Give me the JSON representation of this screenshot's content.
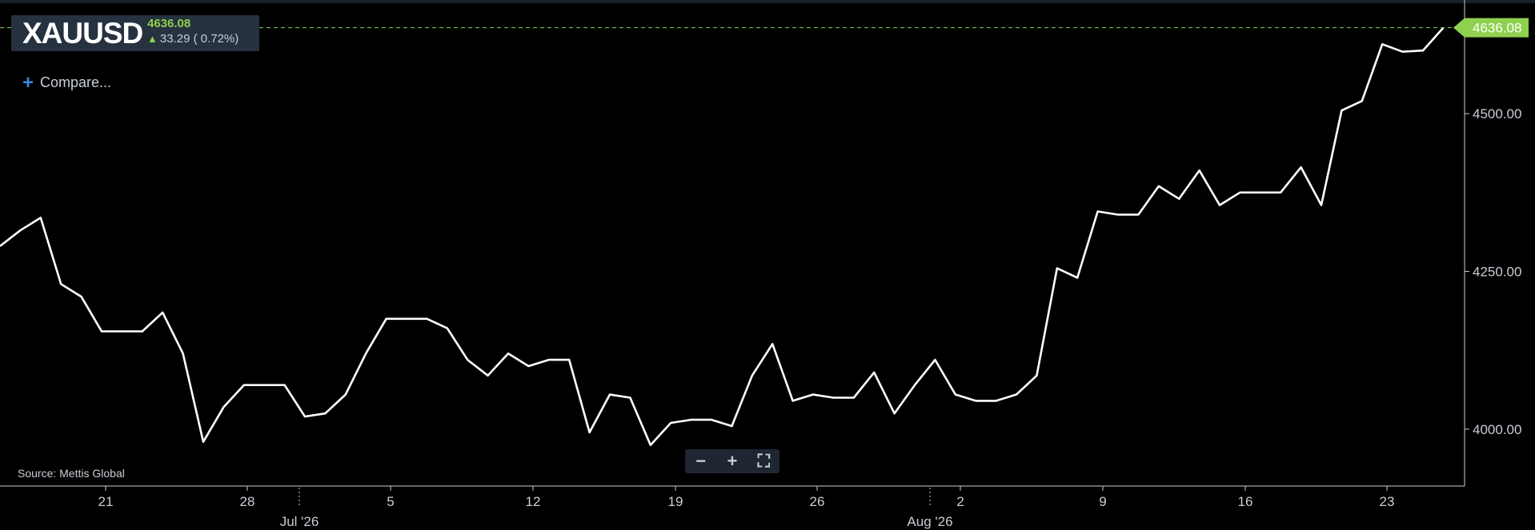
{
  "ticker": {
    "symbol": "XAUUSD",
    "price": "4636.08",
    "change": "33.29 ( 0.72%)"
  },
  "compare_label": "Compare...",
  "source": "Source: Mettis Global",
  "zoom": {
    "minus": "−",
    "plus": "+",
    "fullscreen": "⛶"
  },
  "colors": {
    "line": "#ffffff",
    "accent": "#8fd14f",
    "axis": "#c8ced6",
    "background": "#000000"
  },
  "chart_data": {
    "type": "line",
    "series": [
      {
        "values": [
          4290,
          4315,
          4335,
          4230,
          4210,
          4155,
          4155,
          4155,
          4185,
          4120,
          3980,
          4035,
          4070,
          4070,
          4070,
          4020,
          4025,
          4055,
          4120,
          4175,
          4175,
          4175,
          4160,
          4110,
          4085,
          4120,
          4100,
          4110,
          4110,
          3995,
          4055,
          4050,
          3975,
          4010,
          4015,
          4015,
          4005,
          4085,
          4135,
          4045,
          4055,
          4050,
          4050,
          4090,
          4025,
          4070,
          4110,
          4055,
          4045,
          4045,
          4055,
          4085,
          4255,
          4240,
          4345,
          4340,
          4340,
          4385,
          4365,
          4410,
          4355,
          4375,
          4375,
          4375,
          4415,
          4355,
          4505,
          4520,
          4610,
          4598,
          4600,
          4636.08
        ]
      }
    ],
    "x_tick_labels": [
      "21",
      "28",
      "5",
      "12",
      "19",
      "26",
      "2",
      "9",
      "16",
      "23"
    ],
    "x_month_labels": [
      "Jul '26",
      "Aug '26"
    ],
    "y_tick_labels": [
      "4000.00",
      "4250.00",
      "4500.00"
    ],
    "y_ticks": [
      4000,
      4250,
      4500
    ],
    "ylim": [
      3910,
      4680
    ],
    "last_value": "4636.08",
    "grid": false
  }
}
